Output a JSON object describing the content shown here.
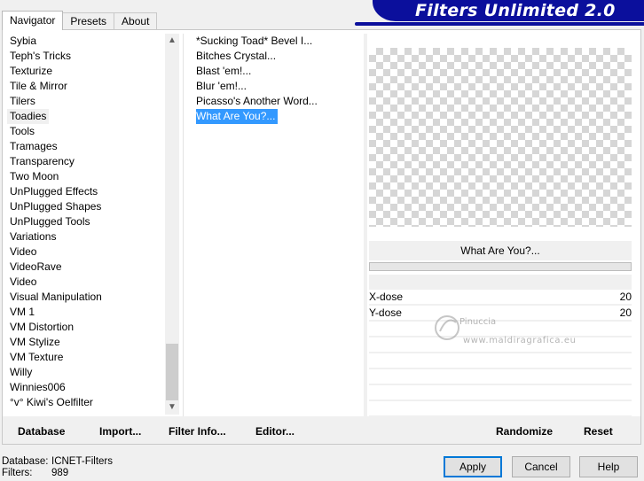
{
  "tabs": [
    {
      "label": "Navigator",
      "active": true
    },
    {
      "label": "Presets",
      "active": false
    },
    {
      "label": "About",
      "active": false
    }
  ],
  "banner": {
    "title": "Filters Unlimited 2.0",
    "color": "#0b0f9c"
  },
  "categories": {
    "items": [
      "Sybia",
      "Teph's Tricks",
      "Texturize",
      "Tile & Mirror",
      "Tilers",
      "Toadies",
      "Tools",
      "Tramages",
      "Transparency",
      "Two Moon",
      "UnPlugged Effects",
      "UnPlugged Shapes",
      "UnPlugged Tools",
      "Variations",
      "Video",
      "VideoRave",
      "Video",
      "Visual Manipulation",
      "VM 1",
      "VM Distortion",
      "VM Stylize",
      "VM Texture",
      "Willy",
      "Winnies006",
      "°v° Kiwi's Oelfilter"
    ],
    "selected": "Toadies",
    "scroll_up_icon": "chevron-up-icon",
    "scroll_down_icon": "chevron-down-icon"
  },
  "filters": {
    "items": [
      "*Sucking Toad*  Bevel I...",
      "Bitches Crystal...",
      "Blast 'em!...",
      "Blur 'em!...",
      "Picasso's Another Word...",
      "What Are You?..."
    ],
    "selected": "What Are You?...",
    "selection_color": "#3399ff"
  },
  "preview": {
    "filter_name": "What Are You?...",
    "progress": 0
  },
  "params": [
    {
      "label": "X-dose",
      "value": "20"
    },
    {
      "label": "Y-dose",
      "value": "20"
    }
  ],
  "watermark": {
    "line1": "Pinuccia",
    "line2": "www.maldiragrafica.eu"
  },
  "bottom_buttons": {
    "database": "Database",
    "import": "Import...",
    "filter_info": "Filter Info...",
    "editor": "Editor...",
    "randomize": "Randomize",
    "reset": "Reset"
  },
  "status": {
    "database_label": "Database:",
    "database_value": "ICNET-Filters",
    "filters_label": "Filters:",
    "filters_value": "989"
  },
  "dialog_buttons": {
    "apply": "Apply",
    "cancel": "Cancel",
    "help": "Help"
  }
}
